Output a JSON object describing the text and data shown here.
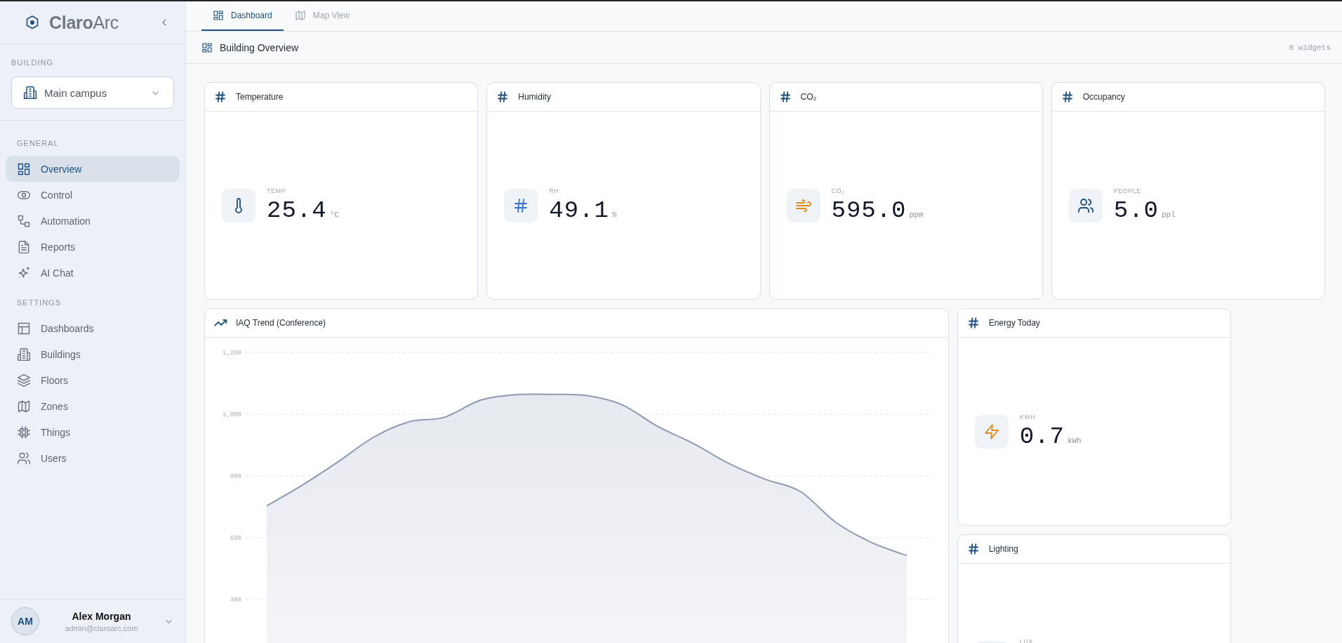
{
  "sidebar": {
    "logo": "**Claro**Arc",
    "building": {
      "label": "BUILDING",
      "value": "Main campus"
    },
    "sections": [
      {
        "title": "GENERAL",
        "items": [
          {
            "label": "Overview",
            "kind": "grid",
            "selected": true
          },
          {
            "label": "Control",
            "kind": "toggle",
            "selected": false
          },
          {
            "label": "Automation",
            "kind": "flow",
            "selected": false
          },
          {
            "label": "Reports",
            "kind": "document",
            "selected": false
          },
          {
            "label": "AI Chat",
            "kind": "sparkle",
            "selected": false
          }
        ]
      },
      {
        "title": "SETTINGS",
        "items": [
          {
            "label": "Dashboards",
            "kind": "layout",
            "selected": false
          },
          {
            "label": "Buildings",
            "kind": "building",
            "selected": false
          },
          {
            "label": "Floors",
            "kind": "layers",
            "selected": false
          },
          {
            "label": "Zones",
            "kind": "map",
            "selected": false
          },
          {
            "label": "Things",
            "kind": "chip",
            "selected": false
          },
          {
            "label": "Users",
            "kind": "users",
            "selected": false
          }
        ]
      }
    ],
    "user": {
      "initials": "AM",
      "name": "Alex Morgan",
      "email": "admin@claroarc.com"
    }
  },
  "tabs": [
    {
      "label": "Dashboard",
      "kind": "grid",
      "selected": true
    },
    {
      "label": "Map View",
      "kind": "map",
      "selected": false
    }
  ],
  "page_header": {
    "title": "Building Overview",
    "count": "8 widgets"
  },
  "widgets": [
    {
      "kind": "metric",
      "title": "Temperature",
      "color": "#1d4f80",
      "label": "TEMP",
      "value": "25.4",
      "unit": "°C"
    },
    {
      "kind": "metric",
      "title": "Humidity",
      "color": "#2f6fdc",
      "label": "RH",
      "value": "49.1",
      "unit": "%"
    },
    {
      "kind": "metric",
      "title": "CO₂",
      "color": "#e08a1e",
      "label": "CO₂",
      "value": "595.0",
      "unit": "ppm"
    },
    {
      "kind": "metric",
      "title": "Occupancy",
      "color": "#1d4f80",
      "label": "PEOPLE",
      "value": "5.0",
      "unit": "ppl"
    },
    {
      "kind": "chart",
      "title": "IAQ Trend (Conference)",
      "chart_data": {
        "type": "area",
        "grid": true,
        "ylim": [
          0,
          1200
        ],
        "yticks": [
          {
            "value": 400,
            "label": "400"
          },
          {
            "value": 600,
            "label": "600"
          },
          {
            "value": 800,
            "label": "800"
          },
          {
            "value": 1000,
            "label": "1,000"
          },
          {
            "value": 1200,
            "label": "1,200"
          }
        ],
        "values": [
          703,
          770,
          845,
          925,
          975,
          990,
          1045,
          1063,
          1064,
          1060,
          1030,
          960,
          905,
          840,
          790,
          750,
          650,
          585,
          542
        ]
      }
    },
    {
      "kind": "metric",
      "title": "Energy Today",
      "color": "#e08a1e",
      "label": "KWH",
      "value": "0.7",
      "unit": "kWh"
    },
    {
      "kind": "metric",
      "title": "Lighting",
      "label": "LUX"
    }
  ]
}
